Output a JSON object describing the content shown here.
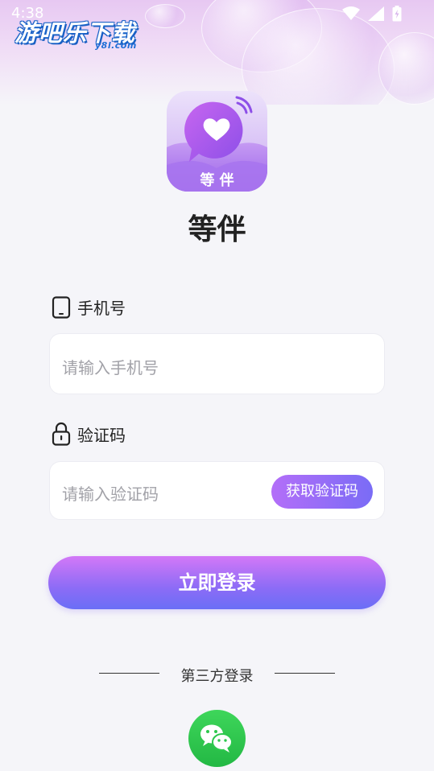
{
  "status_bar": {
    "time": "4:38",
    "icons": [
      "wifi-icon",
      "cellular-signal-icon",
      "battery-charging-icon"
    ]
  },
  "watermark": {
    "main": "游吧乐下载",
    "sub": "y8l.com"
  },
  "app": {
    "logo_icon": "heart-chat-bubble-icon",
    "logo_label": "等 伴",
    "name": "等伴"
  },
  "phone_field": {
    "label": "手机号",
    "icon": "phone-icon",
    "placeholder": "请输入手机号"
  },
  "code_field": {
    "label": "验证码",
    "icon": "lock-icon",
    "placeholder": "请输入验证码",
    "get_code_label": "获取验证码"
  },
  "login_button": "立即登录",
  "third_party": {
    "title": "第三方登录",
    "providers": [
      {
        "name": "wechat",
        "icon": "wechat-icon"
      }
    ]
  },
  "colors": {
    "accent_start": "#d378f7",
    "accent_end": "#6a6ef6",
    "page_bg": "#f5f5f9",
    "wechat_green": "#2dc84d"
  }
}
